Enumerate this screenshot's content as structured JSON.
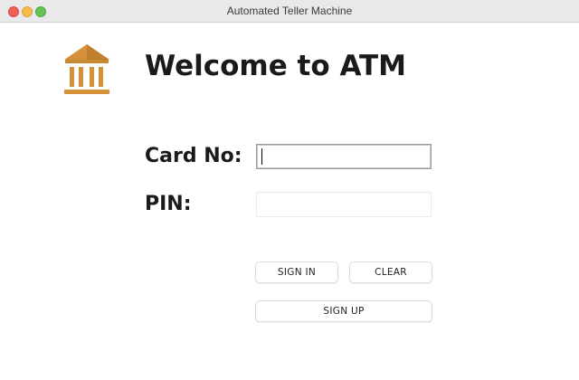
{
  "window": {
    "title": "Automated Teller Machine"
  },
  "header": {
    "icon": "bank-icon",
    "heading": "Welcome to ATM"
  },
  "form": {
    "card_label": "Card No:",
    "card_value": "",
    "pin_label": "PIN:",
    "pin_value": ""
  },
  "buttons": {
    "sign_in": "SIGN IN",
    "clear": "CLEAR",
    "sign_up": "SIGN UP"
  },
  "colors": {
    "icon": "#d4913a",
    "titlebar": "#e9e9e9"
  }
}
